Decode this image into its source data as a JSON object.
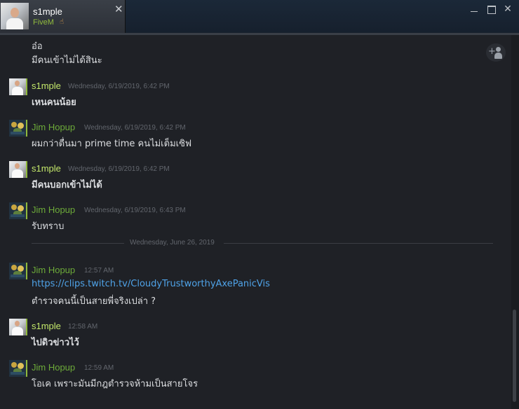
{
  "window": {
    "tab": {
      "name": "s1mple",
      "game": "FiveM",
      "game_icon": "hand-icon",
      "close": "✕"
    },
    "controls": {
      "minimize": "",
      "maximize": "",
      "close": "✕"
    }
  },
  "chat": {
    "date_divider": "Wednesday, June 26, 2019",
    "messages": [
      {
        "sender": "",
        "time": "",
        "lines": [
          "อ๋อ",
          "มีคนเข้าไม่ได้สินะ"
        ]
      },
      {
        "sender": "s1mple",
        "time": "Wednesday, 6/19/2019, 6:42 PM",
        "lines": [
          "เหนคนน้อย"
        ]
      },
      {
        "sender": "Jim Hopup",
        "time": "Wednesday, 6/19/2019, 6:42 PM",
        "lines": [
          "ผมกว่าตื่นมา prime time คนไม่เต็มเซิฟ"
        ]
      },
      {
        "sender": "s1mple",
        "time": "Wednesday, 6/19/2019, 6:42 PM",
        "lines": [
          "มีคนบอกเข้าไม่ได้"
        ]
      },
      {
        "sender": "Jim Hopup",
        "time": "Wednesday, 6/19/2019, 6:43 PM",
        "lines": [
          "รับทราบ"
        ]
      },
      {
        "sender": "Jim Hopup",
        "time": "12:57 AM",
        "lines": [
          "https://clips.twitch.tv/CloudyTrustworthyAxePanicVis",
          "ตำรวจคนนี้เป็นสายพี่จริงเปล่า ?"
        ]
      },
      {
        "sender": "s1mple",
        "time": "12:58 AM",
        "lines": [
          "ไปดิวข่าวไว้"
        ]
      },
      {
        "sender": "Jim Hopup",
        "time": "12:59 AM",
        "lines": [
          "โอเค เพราะมันมีกฎตำรวจห้ามเป็นสายโจร"
        ]
      }
    ]
  },
  "colors": {
    "background": "#1f2126",
    "sender_self": "#c4e86a",
    "sender_other": "#6dab39",
    "link": "#4fa3e8",
    "timestamp": "#62666d",
    "status_online": "#90ba3c"
  },
  "icons": [
    "hand-icon",
    "close-icon",
    "minimize-icon",
    "maximize-icon",
    "add-friend-to-group-icon"
  ]
}
